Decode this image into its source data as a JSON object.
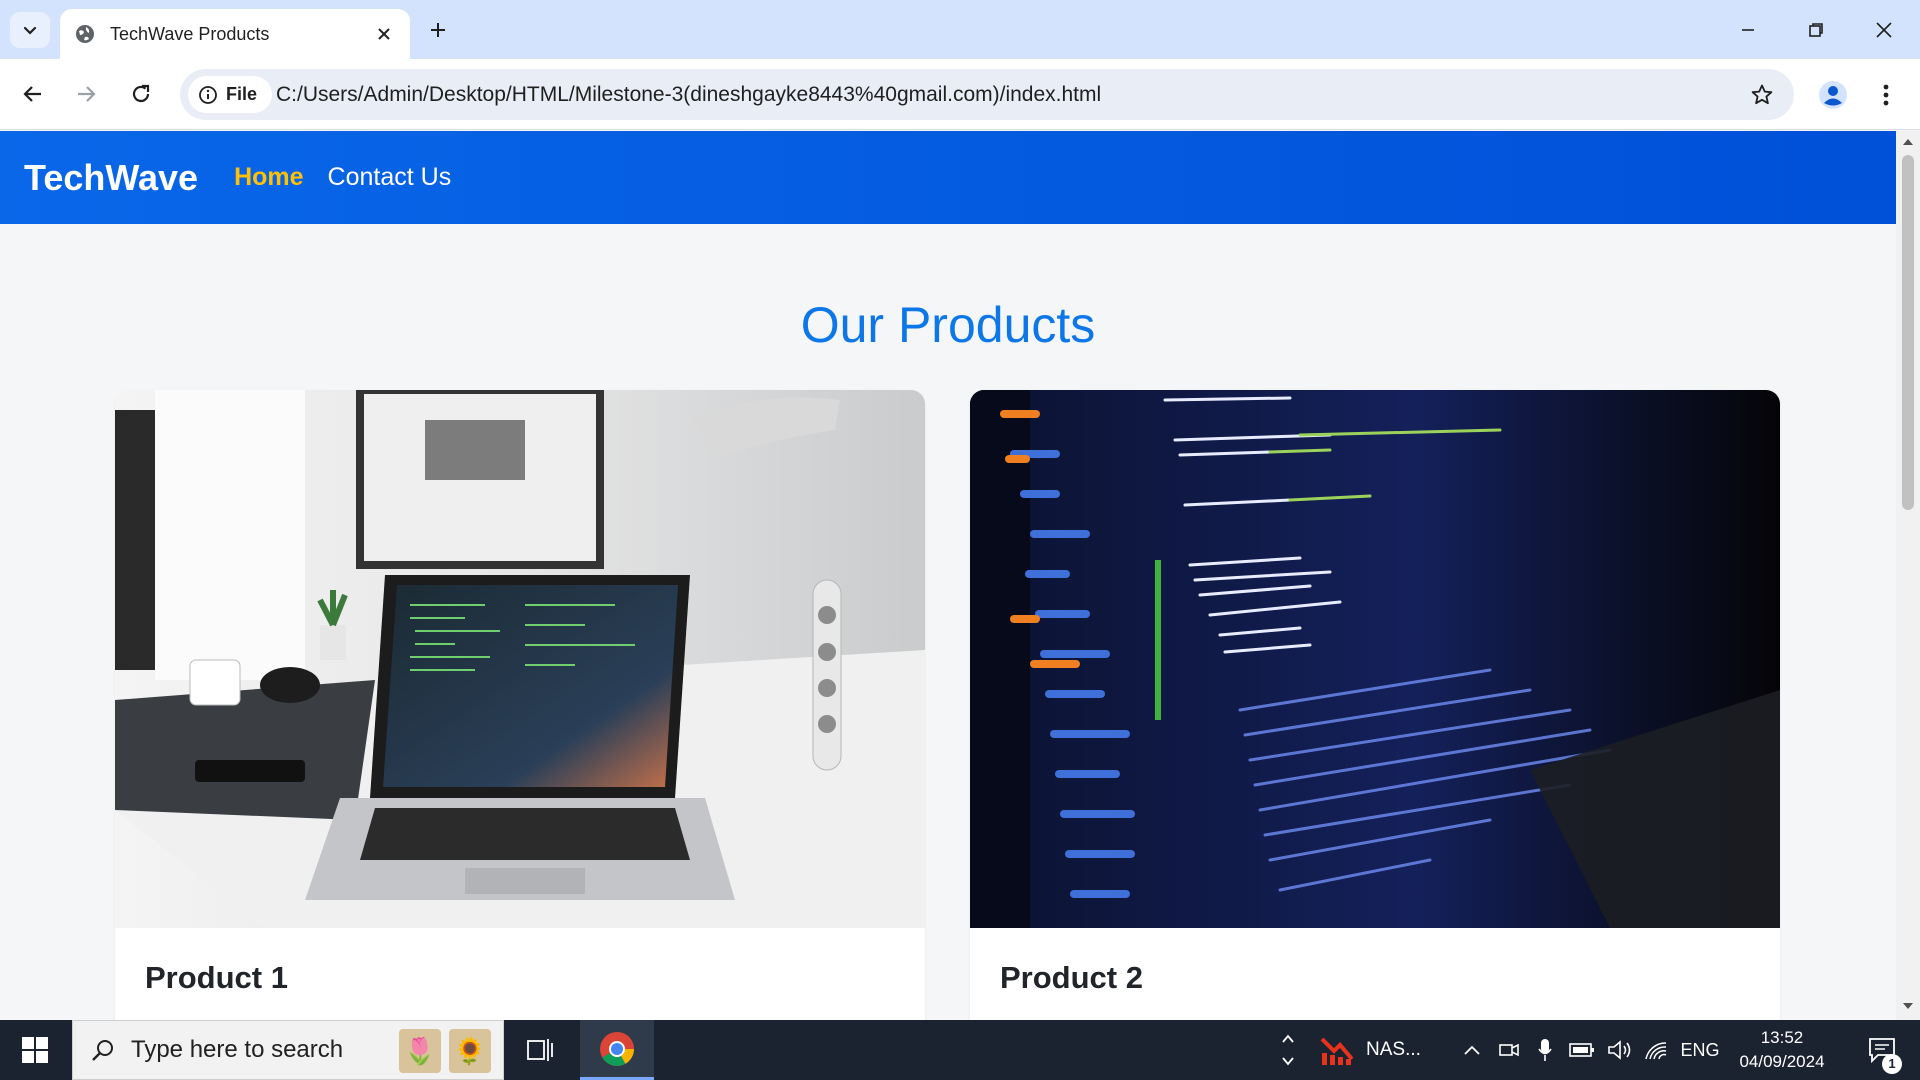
{
  "browser": {
    "tab_title": "TechWave Products",
    "chip_label": "File",
    "url": "C:/Users/Admin/Desktop/HTML/Milestone-3(dineshgayke8443%40gmail.com)/index.html"
  },
  "site": {
    "brand": "TechWave",
    "nav": [
      {
        "label": "Home",
        "active": true
      },
      {
        "label": "Contact Us",
        "active": false
      }
    ],
    "section_title": "Our Products",
    "products": [
      {
        "title": "Product 1",
        "image": "laptop-on-desk"
      },
      {
        "title": "Product 2",
        "image": "code-on-screen"
      }
    ]
  },
  "taskbar": {
    "search_placeholder": "Type here to search",
    "app_label": "NAS...",
    "language": "ENG",
    "time": "13:52",
    "date": "04/09/2024",
    "notification_count": "1"
  },
  "colors": {
    "nav_bg": "#0a63e6",
    "nav_active": "#ffc107",
    "title_blue": "#0d77e8",
    "taskbar_bg": "#1b2330"
  }
}
